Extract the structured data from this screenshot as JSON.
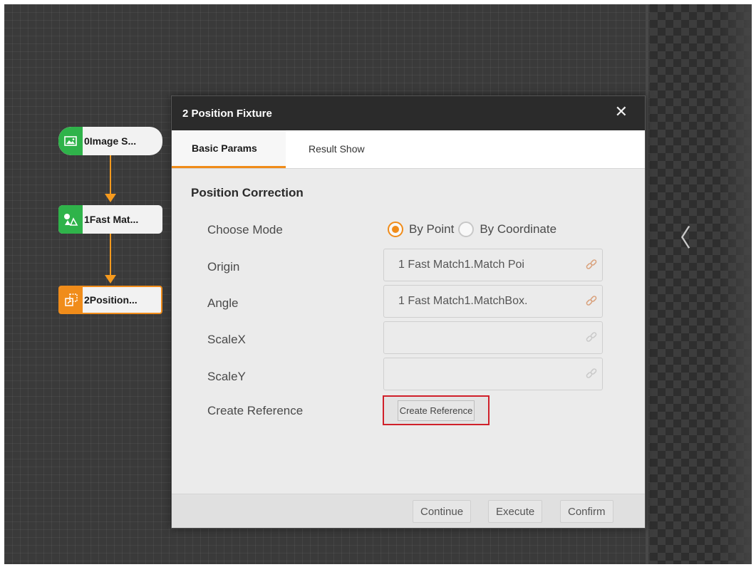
{
  "flow": {
    "nodes": [
      {
        "label": "0Image S...",
        "icon": "image-icon"
      },
      {
        "label": "1Fast Mat...",
        "icon": "shape-match-icon"
      },
      {
        "label": "2Position...",
        "icon": "position-fixture-icon"
      }
    ]
  },
  "dialog": {
    "title": "2 Position Fixture",
    "close_symbol": "✕",
    "tabs": [
      {
        "label": "Basic Params",
        "active": true
      },
      {
        "label": "Result Show",
        "active": false
      }
    ],
    "section_title": "Position Correction",
    "choose_mode": {
      "label": "Choose Mode",
      "options": [
        {
          "label": "By Point",
          "selected": true
        },
        {
          "label": "By Coordinate",
          "selected": false
        }
      ]
    },
    "fields": [
      {
        "label": "Origin",
        "value": "1 Fast Match1.Match Poi"
      },
      {
        "label": "Angle",
        "value": "1 Fast Match1.MatchBox."
      },
      {
        "label": "ScaleX",
        "value": ""
      },
      {
        "label": "ScaleY",
        "value": ""
      }
    ],
    "create_reference": {
      "label": "Create Reference",
      "button_label": "Create Reference"
    },
    "footer": {
      "continue_label": "Continue",
      "execute_label": "Execute",
      "confirm_label": "Confirm"
    }
  },
  "side_panel": {
    "collapse_symbol": "〈"
  },
  "colors": {
    "accent": "#f08c1a",
    "node_green": "#2fb34a",
    "highlight_red": "#d0202a",
    "title_bar": "#2b2b2b"
  }
}
